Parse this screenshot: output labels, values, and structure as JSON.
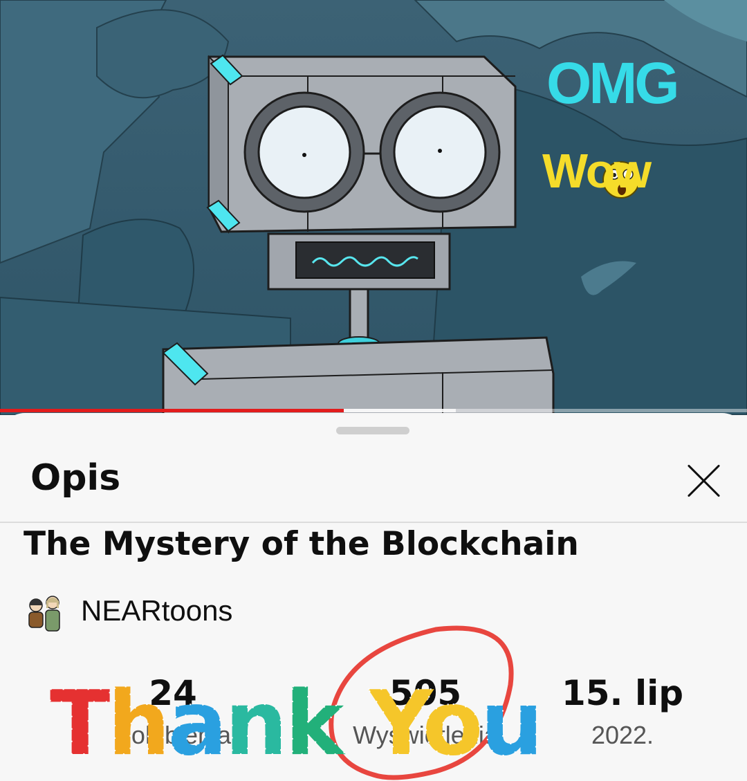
{
  "video": {
    "progress_percent": 46,
    "buffer_percent": 61,
    "stickers": {
      "omg": "OMG",
      "wow": "Wow"
    }
  },
  "sheet": {
    "title": "Opis",
    "close_icon": "close-icon"
  },
  "details": {
    "video_title": "The Mystery of the Blockchain",
    "channel_name": "NEARtoons",
    "stats": [
      {
        "value": "24",
        "label": "Polubienia"
      },
      {
        "value": "505",
        "label": "Wyświetlenia"
      },
      {
        "value": "15. lip",
        "label": "2022."
      }
    ]
  },
  "overlay": {
    "text": "Thank You"
  }
}
